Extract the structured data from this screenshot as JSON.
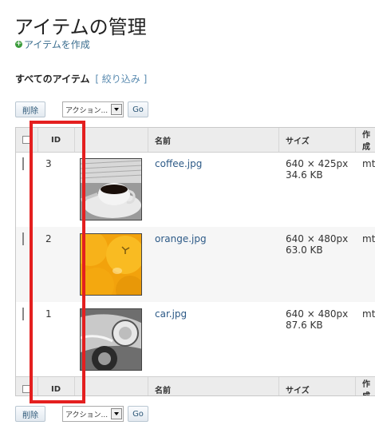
{
  "page": {
    "title": "アイテムの管理",
    "create_link": "アイテムを作成"
  },
  "filter": {
    "heading": "すべてのアイテム",
    "filter_link": "[ 絞り込み ]"
  },
  "actions": {
    "delete_label": "削除",
    "action_select": "アクション...",
    "go_label": "Go"
  },
  "table": {
    "columns": {
      "id": "ID",
      "name": "名前",
      "size": "サイズ",
      "author": "作成"
    },
    "rows": [
      {
        "id": "3",
        "name": "coffee.jpg",
        "dimensions": "640 × 425px",
        "filesize": "34.6 KB",
        "author": "mt"
      },
      {
        "id": "2",
        "name": "orange.jpg",
        "dimensions": "640 × 480px",
        "filesize": "63.0 KB",
        "author": "mt"
      },
      {
        "id": "1",
        "name": "car.jpg",
        "dimensions": "640 × 480px",
        "filesize": "87.6 KB",
        "author": "mt"
      }
    ]
  },
  "highlight_color": "#e41f1f"
}
